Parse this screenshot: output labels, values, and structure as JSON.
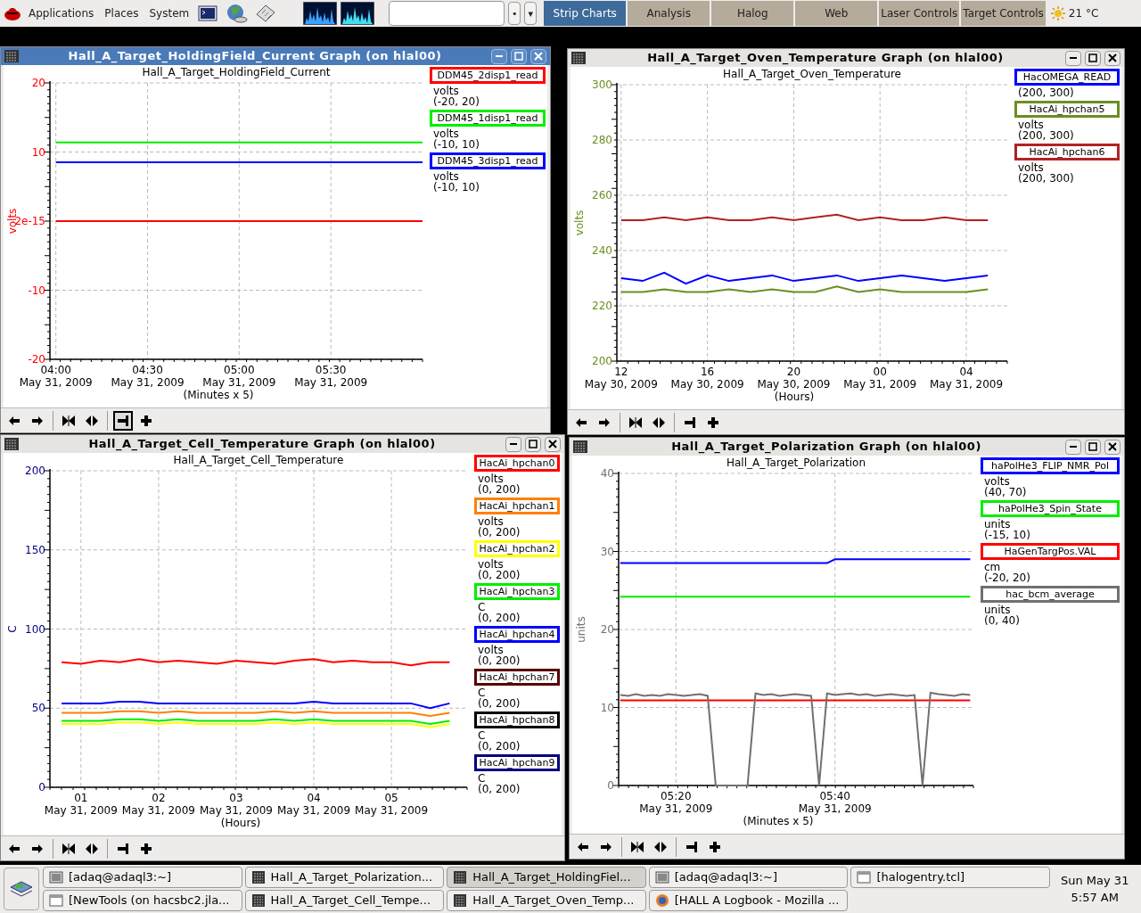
{
  "top_panel": {
    "menus": [
      "Applications",
      "Places",
      "System"
    ],
    "launchers": [
      {
        "kind": "terminal"
      },
      {
        "kind": "globe"
      },
      {
        "kind": "calculator"
      }
    ],
    "command_buttons": [
      "•",
      "▾"
    ],
    "tabs": [
      {
        "label": "Strip Charts",
        "selected": true
      },
      {
        "label": "Analysis",
        "selected": false
      },
      {
        "label": "Halog",
        "selected": false
      },
      {
        "label": "Web",
        "selected": false
      },
      {
        "label": "Laser Controls",
        "selected": false
      },
      {
        "label": "Target Controls",
        "selected": false
      }
    ],
    "weather": "21 °C"
  },
  "windows": [
    {
      "title": "Hall_A_Target_HoldingField_Current Graph (on hlal00)",
      "active": true,
      "chart_data": {
        "type": "line",
        "grid": true,
        "title": "Hall_A_Target_HoldingField_Current",
        "ylabel": "volts",
        "xlabel": "(Minutes x 5)",
        "ylim": [
          -20,
          20
        ],
        "categories": [
          "04:00\nMay 31, 2009",
          null,
          "04:30\nMay 31, 2009",
          null,
          "05:00\nMay 31, 2009",
          null,
          "05:30\nMay 31, 2009",
          null,
          null
        ],
        "yticks": [
          20,
          10,
          {
            "value": 0,
            "label": "2e-15"
          },
          -10,
          -20
        ],
        "series": [
          {
            "name": "DDM45_2disp1_read",
            "color": "#ff0000",
            "values": [
              0,
              0,
              0,
              0,
              0,
              0,
              0,
              0,
              0
            ]
          },
          {
            "name": "DDM45_1disp1_read",
            "color": "#00ee00",
            "values": [
              11.4,
              11.4,
              11.4,
              11.4,
              11.4,
              11.4,
              11.4,
              11.4,
              11.4
            ]
          },
          {
            "name": "DDM45_3disp1_read",
            "color": "#0000ff",
            "values": [
              8.5,
              8.5,
              8.5,
              8.5,
              8.5,
              8.5,
              8.5,
              8.5,
              8.5
            ]
          }
        ]
      },
      "legend": [
        {
          "unit": "volts",
          "range": "(-20, 20)"
        },
        {
          "unit": "volts",
          "range": "(-10, 10)"
        },
        {
          "unit": "volts",
          "range": "(-10, 10)"
        }
      ],
      "toolbar": [
        {
          "kind": "left",
          "pressed": false
        },
        {
          "kind": "right",
          "pressed": false
        },
        {
          "kind": "zoom-in",
          "pressed": false
        },
        {
          "kind": "zoom-out",
          "pressed": false
        },
        {
          "kind": "pin",
          "pressed": true
        },
        {
          "kind": "add",
          "pressed": false
        }
      ]
    },
    {
      "title": "Hall_A_Target_Oven_Temperature Graph (on hlal00)",
      "active": false,
      "chart_data": {
        "type": "line",
        "grid": true,
        "title": "Hall_A_Target_Oven_Temperature",
        "ylabel": "volts",
        "xlabel": "(Hours)",
        "ylim": [
          200,
          300
        ],
        "categories": [
          "12\nMay 30, 2009",
          null,
          null,
          null,
          "16\nMay 30, 2009",
          null,
          null,
          null,
          "20\nMay 30, 2009",
          null,
          null,
          null,
          "00\nMay 31, 2009",
          null,
          null,
          null,
          "04\nMay 31, 2009",
          null
        ],
        "yticks": [
          300,
          280,
          260,
          240,
          220,
          200
        ],
        "series": [
          {
            "name": "HacOMEGA_READ",
            "color": "#0000ff",
            "values": [
              230,
              229,
              232,
              228,
              231,
              229,
              230,
              231,
              229,
              230,
              231,
              229,
              230,
              231,
              230,
              229,
              230,
              231
            ]
          },
          {
            "name": "HacAi_hpchan5",
            "color": "#6b8e23",
            "values": [
              225,
              225,
              226,
              225,
              225,
              226,
              225,
              226,
              225,
              225,
              227,
              225,
              226,
              225,
              225,
              225,
              225,
              226
            ]
          },
          {
            "name": "HacAi_hpchan6",
            "color": "#b22222",
            "values": [
              251,
              251,
              252,
              251,
              252,
              251,
              251,
              252,
              251,
              252,
              253,
              251,
              252,
              251,
              251,
              252,
              251,
              251
            ]
          }
        ]
      },
      "legend": [
        {
          "range": "(200, 300)"
        },
        {
          "unit": "volts",
          "range": "(200, 300)"
        },
        {
          "unit": "volts",
          "range": "(200, 300)"
        }
      ],
      "toolbar": [
        {
          "kind": "left",
          "pressed": false
        },
        {
          "kind": "right",
          "pressed": false
        },
        {
          "kind": "zoom-in",
          "pressed": false
        },
        {
          "kind": "zoom-out",
          "pressed": false
        },
        {
          "kind": "pin",
          "pressed": false
        },
        {
          "kind": "add",
          "pressed": false
        }
      ]
    },
    {
      "title": "Hall_A_Target_Cell_Temperature Graph (on hlal00)",
      "active": false,
      "chart_data": {
        "type": "line",
        "grid": true,
        "title": "Hall_A_Target_Cell_Temperature",
        "ylabel": "C",
        "xlabel": "(Hours)",
        "ylim": [
          0,
          200
        ],
        "categories": [
          null,
          "01\nMay 31, 2009",
          null,
          null,
          null,
          "02\nMay 31, 2009",
          null,
          null,
          null,
          "03\nMay 31, 2009",
          null,
          null,
          null,
          "04\nMay 31, 2009",
          null,
          null,
          null,
          "05\nMay 31, 2009",
          null,
          null,
          null
        ],
        "yticks": [
          200,
          150,
          100,
          50,
          0
        ],
        "series": [
          {
            "name": "HacAi_hpchan0",
            "color": "#ff0000",
            "values": [
              79,
              78,
              80,
              79,
              81,
              79,
              80,
              79,
              78,
              80,
              79,
              78,
              80,
              81,
              79,
              80,
              79,
              79,
              77,
              79,
              79
            ]
          },
          {
            "name": "HacAi_hpchan1",
            "color": "#ff8000",
            "values": [
              47,
              47,
              47,
              48,
              48,
              47,
              48,
              47,
              47,
              47,
              47,
              48,
              47,
              48,
              47,
              47,
              47,
              47,
              47,
              45,
              47
            ]
          },
          {
            "name": "HacAi_hpchan2",
            "color": "#ffff00",
            "values": [
              40,
              40,
              40,
              41,
              41,
              40,
              41,
              40,
              40,
              40,
              40,
              41,
              40,
              41,
              40,
              40,
              40,
              40,
              40,
              38,
              40
            ]
          },
          {
            "name": "HacAi_hpchan3",
            "color": "#00ee00",
            "values": [
              42,
              42,
              42,
              43,
              43,
              42,
              43,
              42,
              42,
              42,
              42,
              43,
              42,
              43,
              42,
              42,
              42,
              42,
              42,
              40,
              42
            ]
          },
          {
            "name": "HacAi_hpchan4",
            "color": "#0000ff",
            "values": [
              53,
              53,
              53,
              54,
              54,
              53,
              53,
              53,
              53,
              53,
              53,
              53,
              53,
              54,
              53,
              53,
              53,
              53,
              53,
              50,
              53
            ]
          },
          {
            "name": "HacAi_hpchan7",
            "color": "#5a0000",
            "values": [
              null,
              null,
              null,
              null,
              null,
              null,
              null,
              null,
              null,
              null,
              null,
              null,
              null,
              null,
              null,
              null,
              null,
              null,
              null,
              null,
              null
            ]
          },
          {
            "name": "HacAi_hpchan8",
            "color": "#000000",
            "values": [
              null,
              null,
              null,
              null,
              null,
              null,
              null,
              null,
              null,
              null,
              null,
              null,
              null,
              null,
              null,
              null,
              null,
              null,
              null,
              null,
              null
            ]
          },
          {
            "name": "HacAi_hpchan9",
            "color": "#000080",
            "values": [
              null,
              null,
              null,
              null,
              null,
              null,
              null,
              null,
              null,
              null,
              null,
              null,
              null,
              null,
              null,
              null,
              null,
              null,
              null,
              null,
              null
            ]
          }
        ]
      },
      "legend": [
        {
          "unit": "volts",
          "range": "(0, 200)"
        },
        {
          "unit": "volts",
          "range": "(0, 200)"
        },
        {
          "unit": "volts",
          "range": "(0, 200)"
        },
        {
          "unit": "C",
          "range": "(0, 200)"
        },
        {
          "unit": "volts",
          "range": "(0, 200)"
        },
        {
          "unit": "C",
          "range": "(0, 200)"
        },
        {
          "unit": "C",
          "range": "(0, 200)"
        },
        {
          "unit": "C",
          "range": "(0, 200)"
        }
      ],
      "toolbar": [
        {
          "kind": "left",
          "pressed": false
        },
        {
          "kind": "right",
          "pressed": false
        },
        {
          "kind": "zoom-in",
          "pressed": false
        },
        {
          "kind": "zoom-out",
          "pressed": false
        },
        {
          "kind": "pin",
          "pressed": false
        },
        {
          "kind": "add",
          "pressed": false
        }
      ]
    },
    {
      "title": "Hall_A_Target_Polarization Graph (on hlal00)",
      "active": false,
      "chart_data": {
        "type": "line",
        "grid": true,
        "title": "Hall_A_Target_Polarization",
        "ylabel": "units",
        "xlabel": "(Minutes x 5)",
        "ylim": [
          0,
          40
        ],
        "categories": [
          null,
          null,
          null,
          null,
          null,
          null,
          null,
          "05:20\nMay 31, 2009",
          null,
          null,
          null,
          null,
          null,
          null,
          null,
          null,
          null,
          null,
          null,
          null,
          null,
          null,
          null,
          null,
          null,
          null,
          null,
          "05:40\nMay 31, 2009",
          null,
          null,
          null,
          null,
          null,
          null,
          null,
          null,
          null,
          null,
          null,
          null,
          null,
          null,
          null,
          null,
          null
        ],
        "yticks": [
          40,
          30,
          20,
          10,
          0
        ],
        "series": [
          {
            "name": "haPolHe3_FLIP_NMR_Pol",
            "color": "#0000ff",
            "values": [
              28.5,
              28.5,
              28.5,
              28.5,
              28.5,
              28.5,
              28.5,
              28.5,
              28.5,
              28.5,
              28.5,
              28.5,
              28.5,
              28.5,
              28.5,
              28.5,
              28.5,
              28.5,
              28.5,
              28.5,
              28.5,
              28.5,
              28.5,
              28.5,
              28.5,
              28.5,
              28.5,
              29,
              29,
              29,
              29,
              29,
              29,
              29,
              29,
              29,
              29,
              29,
              29,
              29,
              29,
              29,
              29,
              29,
              29
            ]
          },
          {
            "name": "haPolHe3_Spin_State",
            "color": "#00ee00",
            "values": [
              24.2,
              24.2,
              24.2,
              24.2,
              24.2,
              24.2,
              24.2,
              24.2,
              24.2,
              24.2,
              24.2,
              24.2,
              24.2,
              24.2,
              24.2,
              24.2,
              24.2,
              24.2,
              24.2,
              24.2,
              24.2,
              24.2,
              24.2,
              24.2,
              24.2,
              24.2,
              24.2,
              24.2,
              24.2,
              24.2,
              24.2,
              24.2,
              24.2,
              24.2,
              24.2,
              24.2,
              24.2,
              24.2,
              24.2,
              24.2,
              24.2,
              24.2,
              24.2,
              24.2,
              24.2
            ]
          },
          {
            "name": "HaGenTargPos.VAL",
            "color": "#ff0000",
            "values": [
              10.9,
              10.9,
              10.9,
              10.9,
              10.9,
              10.9,
              10.9,
              10.9,
              10.9,
              10.9,
              10.9,
              10.9,
              10.9,
              10.9,
              10.9,
              10.9,
              10.9,
              10.9,
              10.9,
              10.9,
              10.9,
              10.9,
              10.9,
              10.9,
              10.9,
              10.9,
              10.9,
              10.9,
              10.9,
              10.9,
              10.9,
              10.9,
              10.9,
              10.9,
              10.9,
              10.9,
              10.9,
              10.9,
              10.9,
              10.9,
              10.9,
              10.9,
              10.9,
              10.9,
              10.9
            ]
          },
          {
            "name": "hac_bcm_average",
            "color": "#707070",
            "values": [
              11.6,
              11.5,
              11.7,
              11.5,
              11.6,
              11.5,
              11.7,
              11.6,
              11.5,
              11.6,
              11.7,
              11.5,
              0,
              0,
              0,
              0,
              0,
              11.8,
              11.6,
              11.7,
              11.5,
              11.6,
              11.7,
              11.6,
              11.5,
              0,
              11.8,
              11.6,
              11.7,
              11.8,
              11.6,
              11.7,
              11.5,
              11.6,
              11.7,
              11.6,
              11.5,
              11.6,
              0,
              11.9,
              11.7,
              11.6,
              11.5,
              11.7,
              11.6
            ]
          }
        ]
      },
      "legend": [
        {
          "unit": "volts",
          "range": "(40, 70)"
        },
        {
          "unit": "units",
          "range": "(-15, 10)"
        },
        {
          "unit": "cm",
          "range": "(-20, 20)"
        },
        {
          "unit": "units",
          "range": "(0, 40)"
        }
      ],
      "toolbar": [
        {
          "kind": "left",
          "pressed": false
        },
        {
          "kind": "right",
          "pressed": false
        },
        {
          "kind": "zoom-in",
          "pressed": false
        },
        {
          "kind": "zoom-out",
          "pressed": false
        },
        {
          "kind": "pin",
          "pressed": false
        },
        {
          "kind": "add",
          "pressed": false
        }
      ]
    }
  ],
  "taskbar": {
    "tasks": [
      {
        "label": "[adaq@adaql3:~]",
        "kind": "terminal",
        "selected": false
      },
      {
        "label": "Hall_A_Target_Polarization...",
        "kind": "graph",
        "selected": false
      },
      {
        "label": "Hall_A_Target_HoldingFiel...",
        "kind": "graph",
        "selected": true
      },
      {
        "label": "[adaq@adaql3:~]",
        "kind": "terminal",
        "selected": false
      },
      {
        "label": "[halogentry.tcl]",
        "kind": "window",
        "selected": false
      },
      {
        "label": "[NewTools (on hacsbc2.jla...",
        "kind": "window",
        "selected": false
      },
      {
        "label": "Hall_A_Target_Cell_Tempe...",
        "kind": "graph",
        "selected": false
      },
      {
        "label": "Hall_A_Target_Oven_Temp...",
        "kind": "graph",
        "selected": false
      },
      {
        "label": "[HALL A Logbook - Mozilla ...",
        "kind": "browser",
        "selected": false
      }
    ],
    "clock_date": "Sun May 31",
    "clock_time": "5:57 AM"
  }
}
